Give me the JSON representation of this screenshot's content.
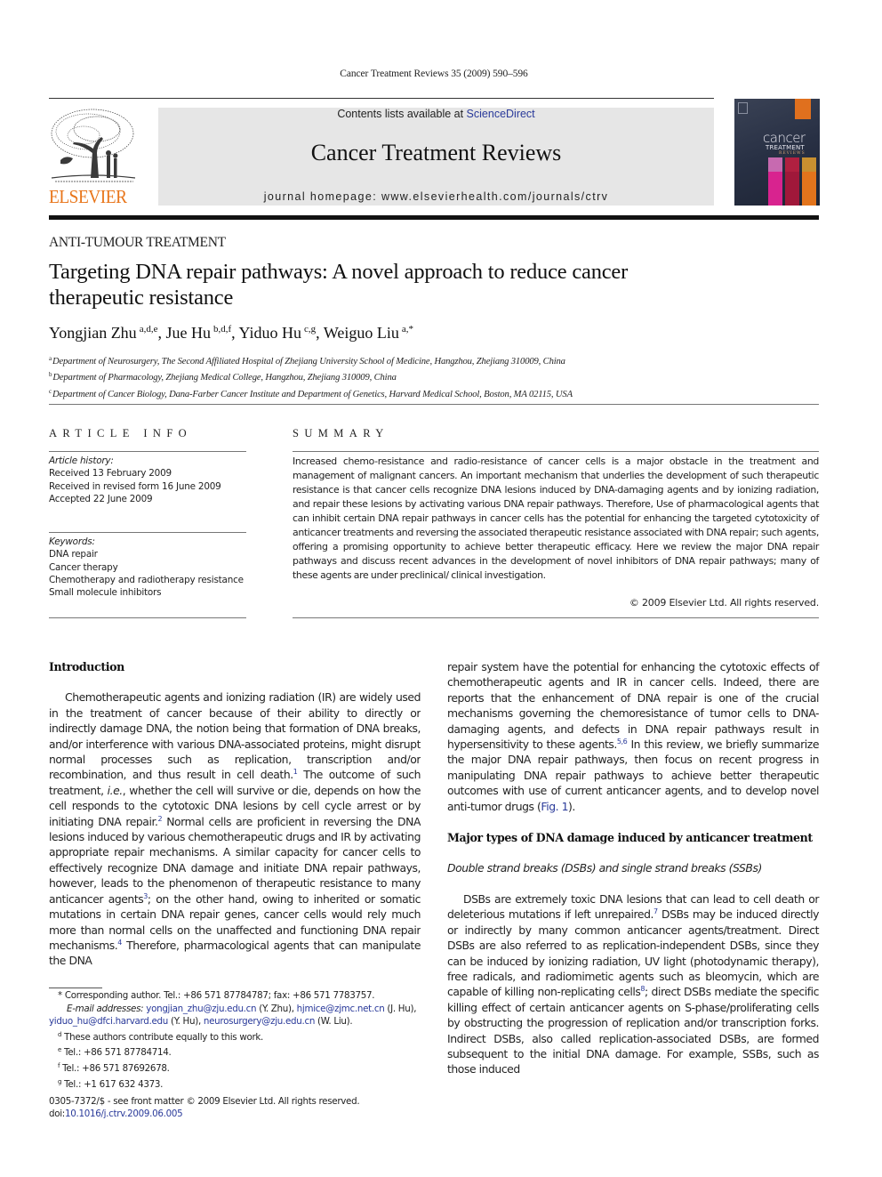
{
  "running_head": "Cancer Treatment Reviews 35 (2009) 590–596",
  "masthead": {
    "publisher_logo_text": "ELSEVIER",
    "contents_prefix": "Contents lists available at ",
    "contents_link": "ScienceDirect",
    "journal_title": "Cancer Treatment Reviews",
    "homepage": "journal homepage: www.elsevierhealth.com/journals/ctrv",
    "cover": {
      "line1": "cancer",
      "line2": "TREATMENT",
      "line3": "REVIEWS"
    },
    "colors": {
      "elsevier_orange": "#e8751a",
      "banner_gray": "#e6e6e6",
      "link_blue": "#2a3a9a"
    }
  },
  "article": {
    "section_label": "ANTI-TUMOUR TREATMENT",
    "title_line1": "Targeting DNA repair pathways: A novel approach to reduce cancer",
    "title_line2": "therapeutic resistance",
    "authors": [
      {
        "name": "Yongjian Zhu",
        "sup": "a,d,e",
        "sep": ", "
      },
      {
        "name": "Jue Hu",
        "sup": "b,d,f",
        "sep": ", "
      },
      {
        "name": "Yiduo Hu",
        "sup": "c,g",
        "sep": ", "
      },
      {
        "name": "Weiguo Liu",
        "sup": "a,*",
        "sep": ""
      }
    ],
    "affiliations": [
      {
        "mark": "a",
        "text": "Department of Neurosurgery, The Second Affiliated Hospital of Zhejiang University School of Medicine, Hangzhou, Zhejiang 310009, China"
      },
      {
        "mark": "b",
        "text": "Department of Pharmacology, Zhejiang Medical College, Hangzhou, Zhejiang 310009, China"
      },
      {
        "mark": "c",
        "text": "Department of Cancer Biology, Dana-Farber Cancer Institute and Department of Genetics, Harvard Medical School, Boston, MA 02115, USA"
      }
    ]
  },
  "article_info": {
    "heading": "ARTICLE INFO",
    "history_label": "Article history:",
    "history": [
      "Received 13 February 2009",
      "Received in revised form 16 June 2009",
      "Accepted 22 June 2009"
    ],
    "keywords_label": "Keywords:",
    "keywords": [
      "DNA repair",
      "Cancer therapy",
      "Chemotherapy and radiotherapy resistance",
      "Small molecule inhibitors"
    ]
  },
  "summary": {
    "heading": "SUMMARY",
    "text": "Increased chemo-resistance and radio-resistance of cancer cells is a major obstacle in the treatment and management of malignant cancers. An important mechanism that underlies the development of such therapeutic resistance is that cancer cells recognize DNA lesions induced by DNA-damaging agents and by ionizing radiation, and repair these lesions by activating various DNA repair pathways. Therefore, Use of pharmacological agents that can inhibit certain DNA repair pathways in cancer cells has the potential for enhancing the targeted cytotoxicity of anticancer treatments and reversing the associated therapeutic resistance associated with DNA repair; such agents, offering a promising opportunity to achieve better therapeutic efficacy. Here we review the major DNA repair pathways and discuss recent advances in the development of novel inhibitors of DNA repair pathways; many of these agents are under preclinical/ clinical investigation.",
    "copyright": "© 2009 Elsevier Ltd. All rights reserved."
  },
  "body": {
    "intro_heading": "Introduction",
    "intro_p1": {
      "t1": "Chemotherapeutic agents and ionizing radiation (IR) are widely used in the treatment of cancer because of their ability to directly or indirectly damage DNA, the notion being that formation of DNA breaks, and/or interference with various DNA-associated proteins, might disrupt normal processes such as replication, transcription and/or recombination, and thus result in cell death.",
      "ref1": "1",
      "t2": " The outcome of such treatment, ",
      "ie": "i.e.",
      "t3": ", whether the cell will survive or die, depends on how the cell responds to the cytotoxic DNA lesions by cell cycle arrest or by initiating DNA repair.",
      "ref2": "2",
      "t4": " Normal cells are proficient in reversing the DNA lesions induced by various chemotherapeutic drugs and IR by activating appropriate repair mechanisms. A similar capacity for cancer cells to effectively recognize DNA damage and initiate DNA repair pathways, however, leads to the phenomenon of therapeutic resistance to many anticancer agents",
      "ref3": "3",
      "t5": "; on the other hand, owing to inherited or somatic mutations in certain DNA repair genes, cancer cells would rely much more than normal cells on the unaffected and functioning DNA repair mechanisms.",
      "ref4": "4",
      "t6": " Therefore, pharmacological agents that can manipulate the DNA repair system have the potential for enhancing the cytotoxic effects of chemotherapeutic agents and IR in cancer cells. Indeed, there are reports that the enhancement of DNA repair is one of the crucial mechanisms governing the chemoresistance of tumor cells to DNA-damaging agents, and defects in DNA repair pathways result in hypersensitivity to these agents.",
      "ref56": "5,6",
      "t7": " In this review, we briefly summarize the major DNA repair pathways, then focus on recent progress in manipulating DNA repair pathways to achieve better therapeutic outcomes with use of current anticancer agents, and to develop novel anti-tumor drugs (",
      "fig_link": "Fig. 1",
      "t8": ")."
    },
    "major_heading": "Major types of DNA damage induced by anticancer treatment",
    "sub_heading": "Double strand breaks (DSBs) and single strand breaks (SSBs)",
    "dsb_p": {
      "t1": "DSBs are extremely toxic DNA lesions that can lead to cell death or deleterious mutations if left unrepaired.",
      "ref7": "7",
      "t2": " DSBs may be induced directly or indirectly by many common anticancer agents/treatment. Direct DSBs are also referred to as replication-independent DSBs, since they can be induced by ionizing radiation, UV light (photodynamic therapy), free radicals, and radiomimetic agents such as bleomycin, which are capable of killing non-replicating cells",
      "ref8": "8",
      "t3": "; direct DSBs mediate the specific killing effect of certain anticancer agents on S-phase/proliferating cells by obstructing the progression of replication and/or transcription forks. Indirect DSBs, also called replication-associated DSBs, are formed subsequent to the initial DNA damage. For example, SSBs, such as those induced"
    }
  },
  "footnotes": {
    "corresponding": "* Corresponding author. Tel.: +86 571 87784787; fax: +86 571 7783757.",
    "email_label": "E-mail addresses:",
    "emails": [
      {
        "addr": "yongjian_zhu@zju.edu.cn",
        "who": " (Y. Zhu), "
      },
      {
        "addr": "hjmice@zjmc.net.cn",
        "who": " (J. Hu), "
      },
      {
        "addr": "yiduo_hu@dfci.harvard.edu",
        "who": " (Y. Hu), "
      },
      {
        "addr": "neurosurgery@zju.edu.cn",
        "who": " (W. Liu)."
      }
    ],
    "notes": [
      {
        "mark": "d",
        "text": "These authors contribute equally to this work."
      },
      {
        "mark": "e",
        "text": "Tel.: +86 571 87784714."
      },
      {
        "mark": "f",
        "text": "Tel.: +86 571 87692678."
      },
      {
        "mark": "g",
        "text": "Tel.: +1 617 632 4373."
      }
    ],
    "issn_line": "0305-7372/$ - see front matter © 2009 Elsevier Ltd. All rights reserved.",
    "doi_prefix": "doi:",
    "doi": "10.1016/j.ctrv.2009.06.005"
  }
}
